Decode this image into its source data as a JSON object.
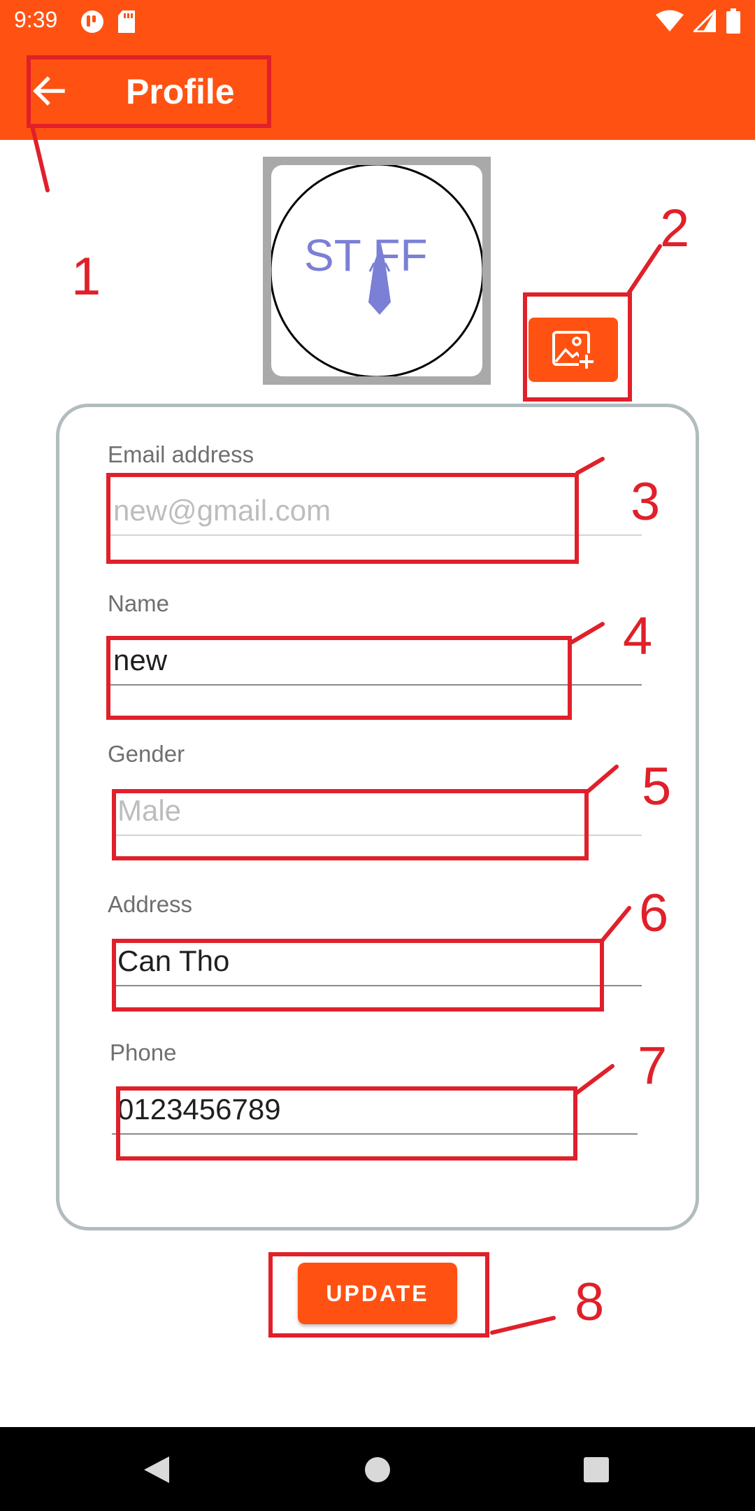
{
  "status_bar": {
    "time": "9:39"
  },
  "app_bar": {
    "title": "Profile"
  },
  "avatar": {
    "logo_text": "ST FF"
  },
  "form": {
    "email": {
      "label": "Email address",
      "value": "",
      "placeholder": "new@gmail.com"
    },
    "name": {
      "label": "Name",
      "value": "new",
      "placeholder": ""
    },
    "gender": {
      "label": "Gender",
      "value": "",
      "placeholder": "Male"
    },
    "address": {
      "label": "Address",
      "value": "Can Tho",
      "placeholder": ""
    },
    "phone": {
      "label": "Phone",
      "value": "0123456789",
      "placeholder": ""
    }
  },
  "update_button": {
    "label": "UPDATE"
  },
  "annotations": [
    "1",
    "2",
    "3",
    "4",
    "5",
    "6",
    "7",
    "8"
  ],
  "colors": {
    "primary": "#ff5212",
    "annotation": "#e0202a",
    "card_border": "#b2bcbf",
    "logo": "#7b7fd6"
  }
}
